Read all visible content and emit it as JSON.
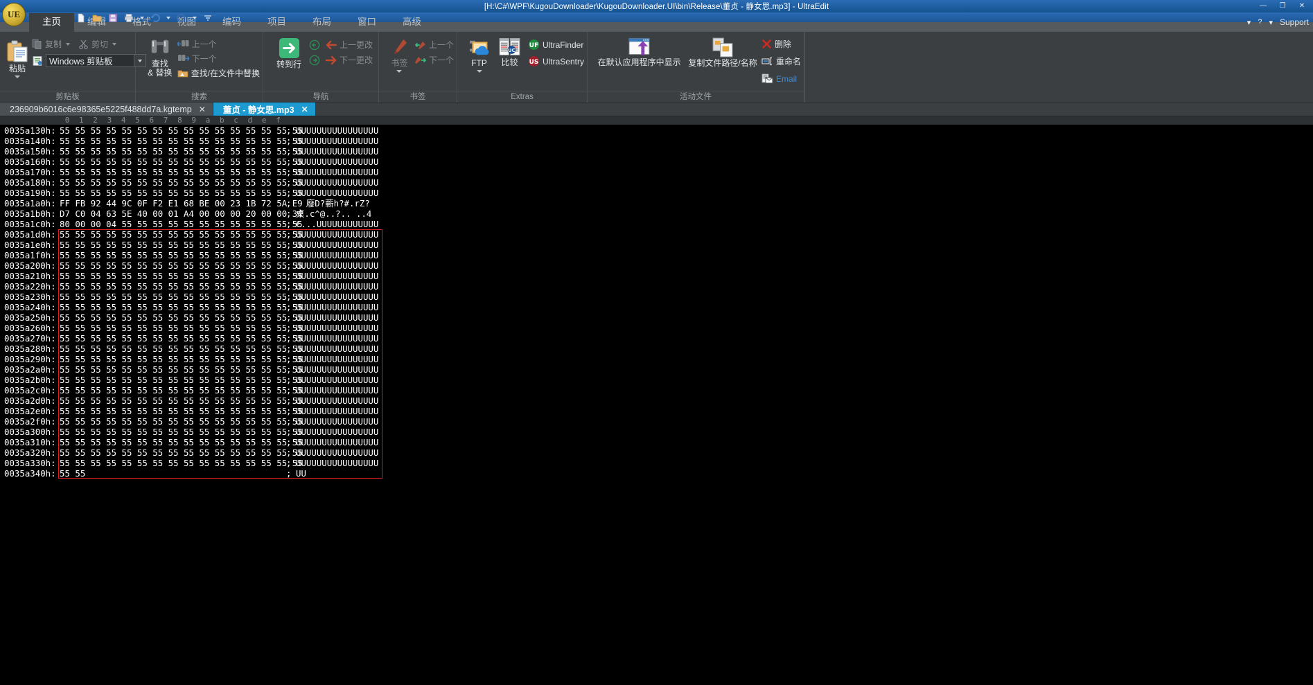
{
  "window": {
    "title": "[H:\\C#\\WPF\\KugouDownloader\\KugouDownloader.UI\\bin\\Release\\董贞 - 静女思.mp3] - UltraEdit",
    "minimize": "—",
    "maximize": "❐",
    "close": "✕"
  },
  "topbar": {
    "logo": "UE",
    "help_glyph": "?",
    "caret_glyph": "▾",
    "support_label": "Support",
    "quick_access": [
      "new-file-icon",
      "open-folder-icon",
      "save-icon",
      "print-icon",
      "undo-icon",
      "redo-icon",
      "customize-qat-icon"
    ]
  },
  "ribbon_tabs": [
    {
      "label": "主页",
      "active": true
    },
    {
      "label": "编辑",
      "active": false
    },
    {
      "label": "格式",
      "active": false
    },
    {
      "label": "视图",
      "active": false
    },
    {
      "label": "编码",
      "active": false
    },
    {
      "label": "项目",
      "active": false
    },
    {
      "label": "布局",
      "active": false
    },
    {
      "label": "窗口",
      "active": false
    },
    {
      "label": "高级",
      "active": false
    }
  ],
  "ribbon": {
    "clipboard": {
      "group_label": "剪贴板",
      "paste_label": "粘贴",
      "copy_label": "复制",
      "cut_label": "剪切",
      "clipboard_combo_value": "Windows 剪贴板"
    },
    "search": {
      "group_label": "搜索",
      "find_replace_label": "查找\n& 替换",
      "find_label_line1": "查找",
      "find_label_line2": "& 替换",
      "prev_label": "上一个",
      "next_label": "下一个",
      "find_in_files_label": "查找/在文件中替换"
    },
    "navigation": {
      "group_label": "导航",
      "goto_line_label": "转到行",
      "prev_change_label": "上一更改",
      "next_change_label": "下一更改"
    },
    "bookmarks": {
      "group_label": "书签",
      "bookmark_label": "书签",
      "prev_label": "上一个",
      "next_label": "下一个"
    },
    "extras": {
      "group_label": "Extras",
      "ftp_label": "FTP",
      "compare_label": "比较",
      "ultrafinder_label": "UltraFinder",
      "ultrasentry_label": "UltraSentry"
    },
    "active_file": {
      "group_label": "活动文件",
      "open_in_default_label": "在默认应用程序中显示",
      "copy_path_label": "复制文件路径/名称",
      "delete_label": "删除",
      "rename_label": "重命名",
      "email_label": "Email"
    }
  },
  "file_tabs": [
    {
      "label": "236909b6016c6e98365e5225f488dd7a.kgtemp",
      "close": "✕",
      "active": false
    },
    {
      "label": "董贞 - 静女思.mp3",
      "close": "✕",
      "active": true
    }
  ],
  "editor": {
    "ruler": [
      "0",
      "1",
      "2",
      "3",
      "4",
      "5",
      "6",
      "7",
      "8",
      "9",
      "a",
      "b",
      "c",
      "d",
      "e",
      "f"
    ],
    "separator": ";",
    "selection_color": "#e02020",
    "rows": [
      {
        "addr": "0035a130h:",
        "bytes": "55 55 55 55 55 55 55 55 55 55 55 55 55 55 55 55",
        "ascii": "UUUUUUUUUUUUUUUU"
      },
      {
        "addr": "0035a140h:",
        "bytes": "55 55 55 55 55 55 55 55 55 55 55 55 55 55 55 55",
        "ascii": "UUUUUUUUUUUUUUUU"
      },
      {
        "addr": "0035a150h:",
        "bytes": "55 55 55 55 55 55 55 55 55 55 55 55 55 55 55 55",
        "ascii": "UUUUUUUUUUUUUUUU"
      },
      {
        "addr": "0035a160h:",
        "bytes": "55 55 55 55 55 55 55 55 55 55 55 55 55 55 55 55",
        "ascii": "UUUUUUUUUUUUUUUU"
      },
      {
        "addr": "0035a170h:",
        "bytes": "55 55 55 55 55 55 55 55 55 55 55 55 55 55 55 55",
        "ascii": "UUUUUUUUUUUUUUUU"
      },
      {
        "addr": "0035a180h:",
        "bytes": "55 55 55 55 55 55 55 55 55 55 55 55 55 55 55 55",
        "ascii": "UUUUUUUUUUUUUUUU"
      },
      {
        "addr": "0035a190h:",
        "bytes": "55 55 55 55 55 55 55 55 55 55 55 55 55 55 55 55",
        "ascii": "UUUUUUUUUUUUUUUU"
      },
      {
        "addr": "0035a1a0h:",
        "bytes": "FF FB 92 44 9C 0F F2 E1 68 BE 00 23 1B 72 5A E9",
        "ascii": "  廢D?蘄h?#.rZ?"
      },
      {
        "addr": "0035a1b0h:",
        "bytes": "D7 C0 04 63 5E 40 00 01 A4 00 00 00 20 00 00 34",
        "ascii": "桌.c^@..?.. ..4"
      },
      {
        "addr": "0035a1c0h:",
        "bytes": "80 00 00 04 55 55 55 55 55 55 55 55 55 55 55 55",
        "ascii": "€...UUUUUUUUUUUU"
      },
      {
        "addr": "0035a1d0h:",
        "bytes": "55 55 55 55 55 55 55 55 55 55 55 55 55 55 55 55",
        "ascii": "UUUUUUUUUUUUUUUU"
      },
      {
        "addr": "0035a1e0h:",
        "bytes": "55 55 55 55 55 55 55 55 55 55 55 55 55 55 55 55",
        "ascii": "UUUUUUUUUUUUUUUU"
      },
      {
        "addr": "0035a1f0h:",
        "bytes": "55 55 55 55 55 55 55 55 55 55 55 55 55 55 55 55",
        "ascii": "UUUUUUUUUUUUUUUU"
      },
      {
        "addr": "0035a200h:",
        "bytes": "55 55 55 55 55 55 55 55 55 55 55 55 55 55 55 55",
        "ascii": "UUUUUUUUUUUUUUUU"
      },
      {
        "addr": "0035a210h:",
        "bytes": "55 55 55 55 55 55 55 55 55 55 55 55 55 55 55 55",
        "ascii": "UUUUUUUUUUUUUUUU"
      },
      {
        "addr": "0035a220h:",
        "bytes": "55 55 55 55 55 55 55 55 55 55 55 55 55 55 55 55",
        "ascii": "UUUUUUUUUUUUUUUU"
      },
      {
        "addr": "0035a230h:",
        "bytes": "55 55 55 55 55 55 55 55 55 55 55 55 55 55 55 55",
        "ascii": "UUUUUUUUUUUUUUUU"
      },
      {
        "addr": "0035a240h:",
        "bytes": "55 55 55 55 55 55 55 55 55 55 55 55 55 55 55 55",
        "ascii": "UUUUUUUUUUUUUUUU"
      },
      {
        "addr": "0035a250h:",
        "bytes": "55 55 55 55 55 55 55 55 55 55 55 55 55 55 55 55",
        "ascii": "UUUUUUUUUUUUUUUU"
      },
      {
        "addr": "0035a260h:",
        "bytes": "55 55 55 55 55 55 55 55 55 55 55 55 55 55 55 55",
        "ascii": "UUUUUUUUUUUUUUUU"
      },
      {
        "addr": "0035a270h:",
        "bytes": "55 55 55 55 55 55 55 55 55 55 55 55 55 55 55 55",
        "ascii": "UUUUUUUUUUUUUUUU"
      },
      {
        "addr": "0035a280h:",
        "bytes": "55 55 55 55 55 55 55 55 55 55 55 55 55 55 55 55",
        "ascii": "UUUUUUUUUUUUUUUU"
      },
      {
        "addr": "0035a290h:",
        "bytes": "55 55 55 55 55 55 55 55 55 55 55 55 55 55 55 55",
        "ascii": "UUUUUUUUUUUUUUUU"
      },
      {
        "addr": "0035a2a0h:",
        "bytes": "55 55 55 55 55 55 55 55 55 55 55 55 55 55 55 55",
        "ascii": "UUUUUUUUUUUUUUUU"
      },
      {
        "addr": "0035a2b0h:",
        "bytes": "55 55 55 55 55 55 55 55 55 55 55 55 55 55 55 55",
        "ascii": "UUUUUUUUUUUUUUUU"
      },
      {
        "addr": "0035a2c0h:",
        "bytes": "55 55 55 55 55 55 55 55 55 55 55 55 55 55 55 55",
        "ascii": "UUUUUUUUUUUUUUUU"
      },
      {
        "addr": "0035a2d0h:",
        "bytes": "55 55 55 55 55 55 55 55 55 55 55 55 55 55 55 55",
        "ascii": "UUUUUUUUUUUUUUUU"
      },
      {
        "addr": "0035a2e0h:",
        "bytes": "55 55 55 55 55 55 55 55 55 55 55 55 55 55 55 55",
        "ascii": "UUUUUUUUUUUUUUUU"
      },
      {
        "addr": "0035a2f0h:",
        "bytes": "55 55 55 55 55 55 55 55 55 55 55 55 55 55 55 55",
        "ascii": "UUUUUUUUUUUUUUUU"
      },
      {
        "addr": "0035a300h:",
        "bytes": "55 55 55 55 55 55 55 55 55 55 55 55 55 55 55 55",
        "ascii": "UUUUUUUUUUUUUUUU"
      },
      {
        "addr": "0035a310h:",
        "bytes": "55 55 55 55 55 55 55 55 55 55 55 55 55 55 55 55",
        "ascii": "UUUUUUUUUUUUUUUU"
      },
      {
        "addr": "0035a320h:",
        "bytes": "55 55 55 55 55 55 55 55 55 55 55 55 55 55 55 55",
        "ascii": "UUUUUUUUUUUUUUUU"
      },
      {
        "addr": "0035a330h:",
        "bytes": "55 55 55 55 55 55 55 55 55 55 55 55 55 55 55 55",
        "ascii": "UUUUUUUUUUUUUUUU"
      },
      {
        "addr": "0035a340h:",
        "bytes": "55 55",
        "ascii": "UU"
      }
    ],
    "selection_start_row": 10,
    "selection_end_row": 33
  }
}
